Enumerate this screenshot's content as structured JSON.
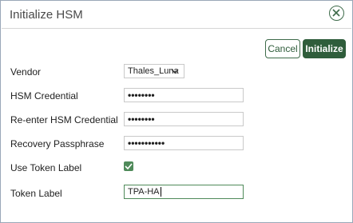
{
  "dialog": {
    "title": "Initialize HSM",
    "close_icon": "close-circle-icon"
  },
  "actions": {
    "cancel_label": "Cancel",
    "initialize_label": "Initialize"
  },
  "form": {
    "vendor": {
      "label": "Vendor",
      "value": "Thales_Luna",
      "icon": "chevron-down-icon"
    },
    "hsm_credential": {
      "label": "HSM Credential",
      "masked_value": "••••••••"
    },
    "reenter_hsm_credential": {
      "label": "Re-enter HSM Credential",
      "masked_value": "••••••••"
    },
    "recovery_passphrase": {
      "label": "Recovery Passphrase",
      "masked_value": "•••••••••••"
    },
    "use_token_label": {
      "label": "Use Token Label",
      "checked": true,
      "icon": "checkmark-icon"
    },
    "token_label": {
      "label": "Token Label",
      "value": "TPA-HA"
    }
  },
  "colors": {
    "accent": "#2f5d3b",
    "checkbox": "#4f8a5a",
    "border": "#9aa7b8"
  }
}
